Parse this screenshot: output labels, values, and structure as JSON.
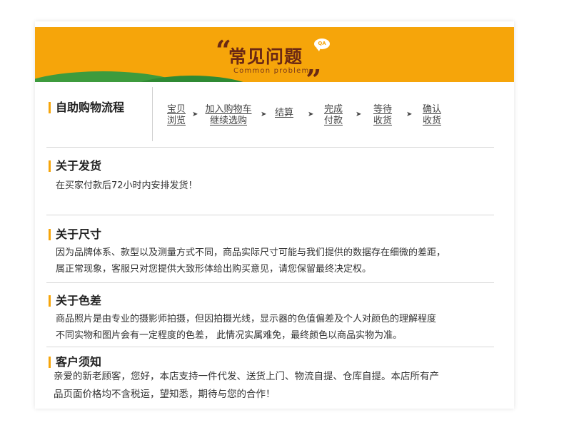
{
  "banner": {
    "quote_open": "“",
    "quote_close": "„",
    "title": "常见问题",
    "subtitle": "Common problem",
    "qa_badge": "QA"
  },
  "process": {
    "title": "自助购物流程",
    "steps": [
      {
        "line1": "宝贝",
        "line2": "浏览"
      },
      {
        "line1": "加入购物车",
        "line2": "继续选购"
      },
      {
        "line1": "结算",
        "line2": ""
      },
      {
        "line1": "完成",
        "line2": "付款"
      },
      {
        "line1": "等待",
        "line2": "收货"
      },
      {
        "line1": "确认",
        "line2": "收货"
      }
    ],
    "arrow": "➤"
  },
  "shipping": {
    "title": "关于发货",
    "text": "在买家付款后72小时内安排发货！"
  },
  "size": {
    "title": "关于尺寸",
    "line1": "因为品牌体系、款型以及测量方式不同，商品实际尺寸可能与我们提供的数据存在细微的差距，",
    "line2": "属正常现象，客服只对您提供大致形体给出购买意见，请您保留最终决定权。"
  },
  "color": {
    "title": "关于色差",
    "line1": "商品照片是由专业的摄影师拍摄，但因拍摄光线，显示器的色值偏差及个人对颜色的理解程度",
    "line2": "不同实物和图片会有一定程度的色差， 此情况实属难免，最终颜色以商品实物为准。"
  },
  "notice": {
    "title": "客户须知",
    "line1": "亲爱的新老顾客，您好，本店支持一件代发、送货上门、物流自提、仓库自提。本店所有产",
    "line2": "品页面价格均不含税运，望知悉，期待与您的合作！"
  },
  "colors": {
    "accent": "#f6a50a",
    "hill": "#3d9b3d",
    "title_brown": "#6b2814"
  }
}
